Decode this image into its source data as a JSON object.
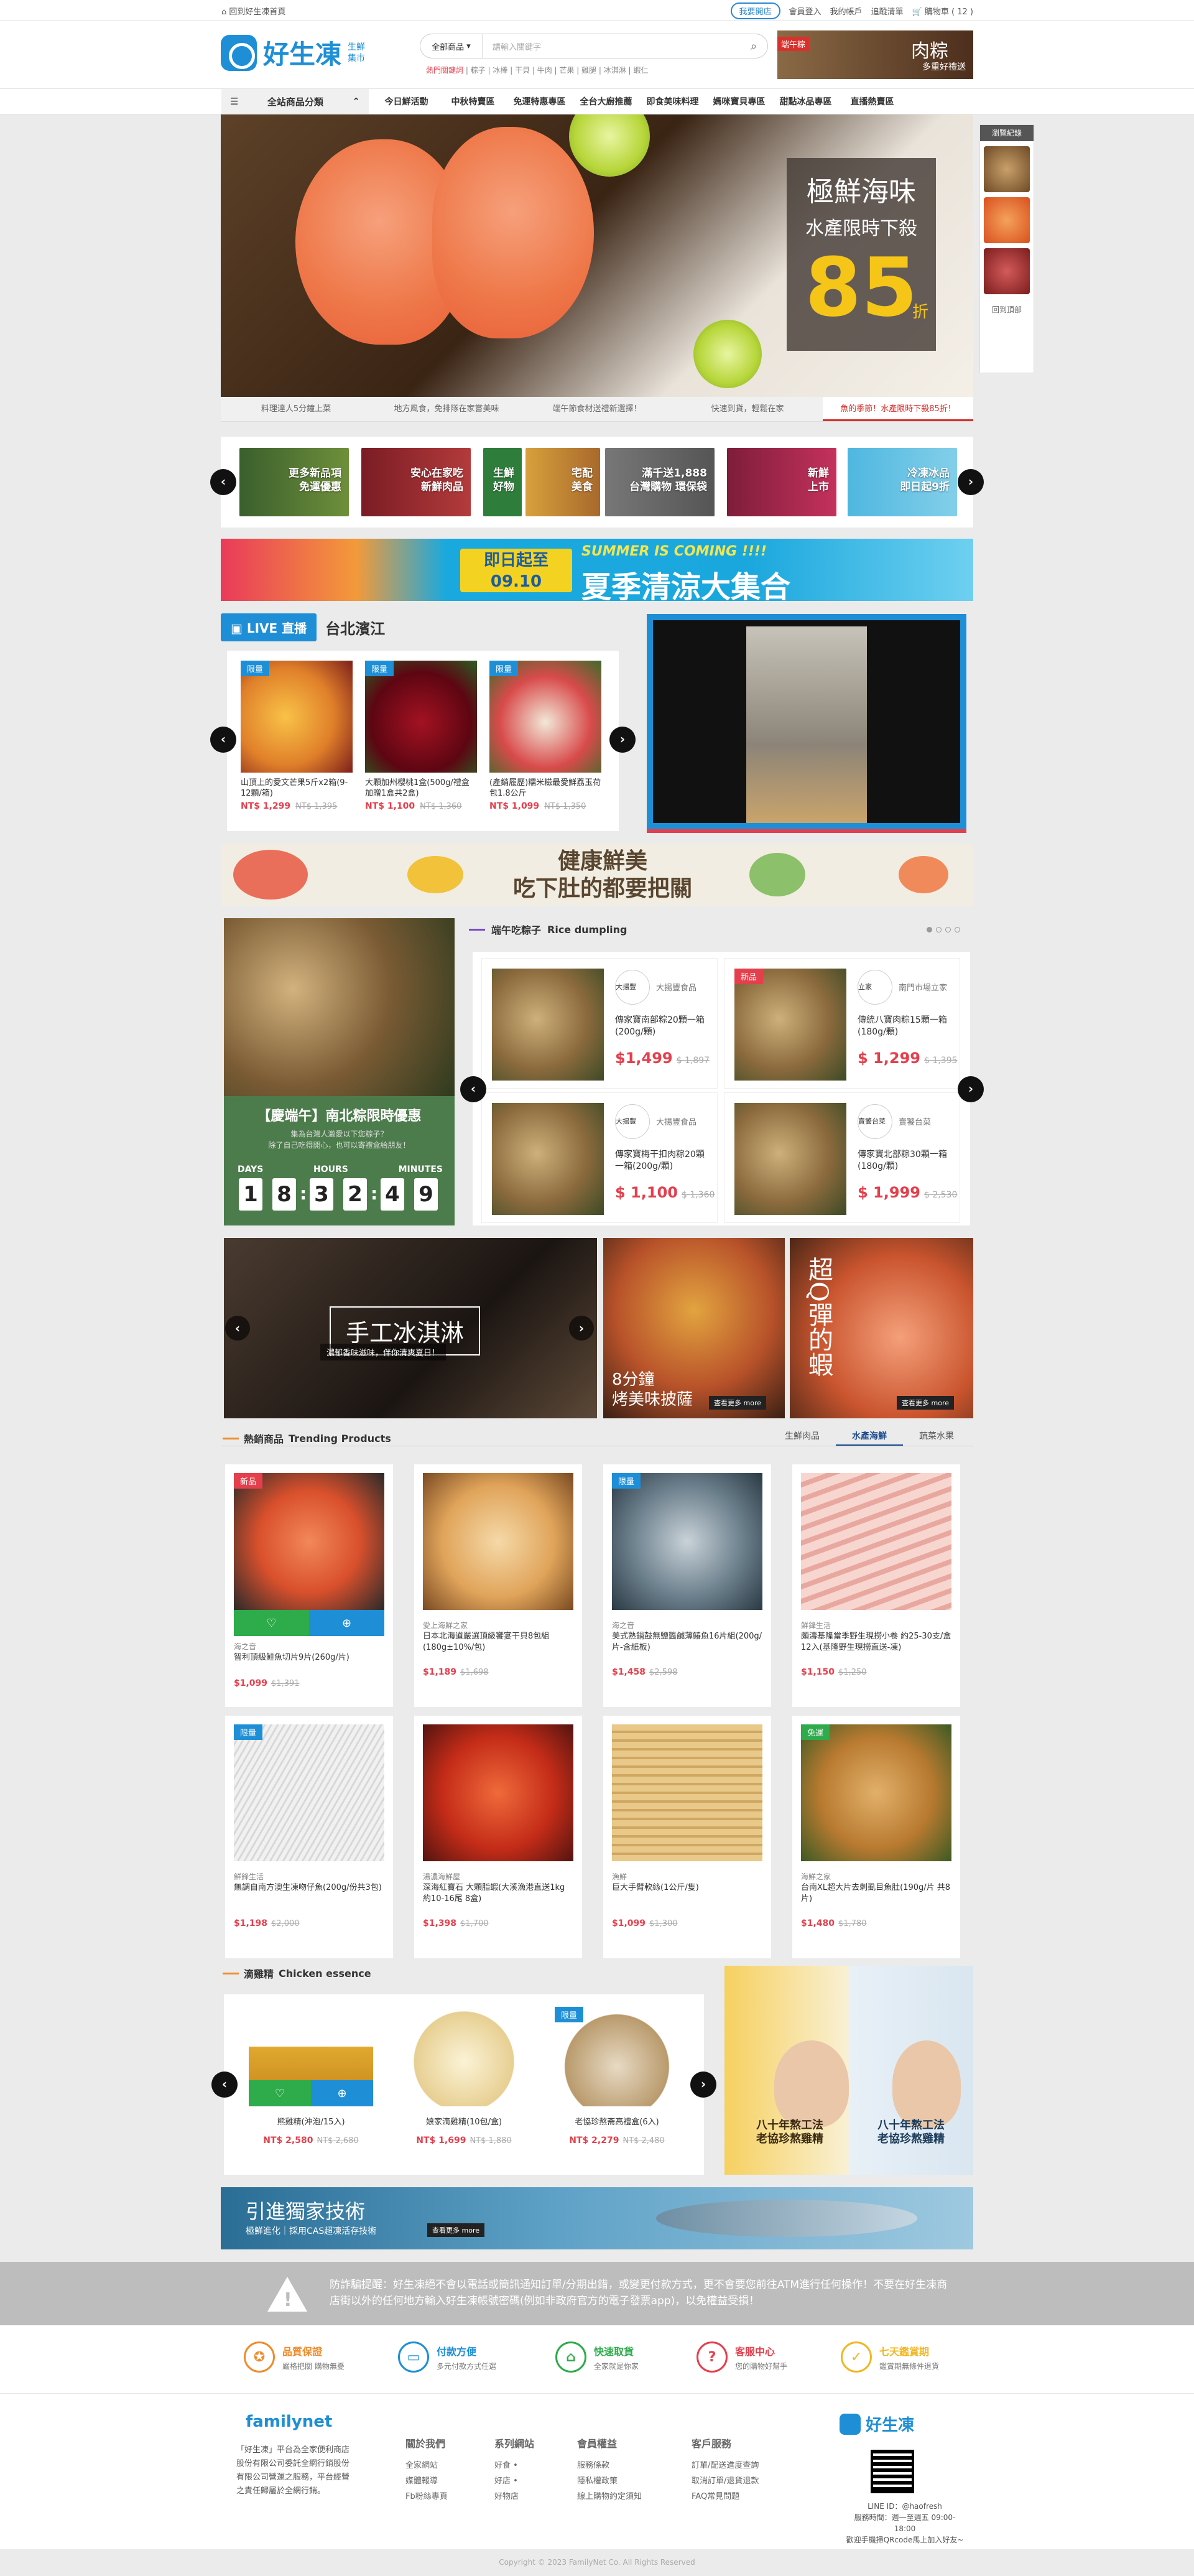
{
  "topbar": {
    "home": "回到好生凍首頁",
    "store_btn": "我要開店",
    "login": "會員登入",
    "account": "我的帳戶",
    "track": "追蹤清單",
    "cart": "購物車 ( 12 )"
  },
  "header": {
    "brand": "好生凍",
    "brand_sub1": "生鮮",
    "brand_sub2": "集市",
    "search_cat": "全部商品",
    "search_placeholder": "請輸入關鍵字",
    "hot_label": "熱門關鍵詞",
    "hot_keywords": "| 粽子 | 冰棒 | 干貝 | 牛肉 | 芒果 | 雞腿 | 冰淇淋 | 蝦仁",
    "ad_tag": "端午粽",
    "ad_title": "肉粽",
    "ad_sub": "多重好禮送"
  },
  "nav": {
    "all": "全站商品分類",
    "items": [
      "今日鮮活動",
      "中秋特賣區",
      "免運特惠專區",
      "全台大廚推薦",
      "即食美味料理",
      "媽咪寶貝專區",
      "甜點冰品專區",
      "直播熱賣區"
    ]
  },
  "banner": {
    "line1": "極鮮海味",
    "line2": "水產限時下殺",
    "number": "85",
    "unit": "折",
    "tabs": [
      "料理達人5分鐘上菜",
      "地方風食，免排隊在家嘗美味",
      "端午節食材送禮新選擇！",
      "快速到貨，輕鬆在家",
      "魚的季節！水產限時下殺85折！"
    ]
  },
  "history": {
    "title": "瀏覽紀錄",
    "footer": "回到頂部"
  },
  "catcar": {
    "tiles": [
      "更多新品項\n免運優惠",
      "安心在家吃\n新鮮肉品",
      "生鮮\n好物",
      "宅配\n美食",
      "滿千送1,888\n台灣購物 環保袋",
      "新鮮\n上市",
      "冷凍冰品\n即日起9折"
    ]
  },
  "summer": {
    "date_top": "即日起至",
    "date": "09.10",
    "tagline": "SUMMER IS COMING !!!!",
    "title": "夏季清涼大集合"
  },
  "live": {
    "badge": "LIVE 直播",
    "location": "台北濱江",
    "products": [
      {
        "badge": "限量",
        "name": "山頂上的愛文芒果5斤x2箱(9-12顆/箱)",
        "price": "NT$ 1,299",
        "old": "NT$ 1,395"
      },
      {
        "badge": "限量",
        "name": "大顆加州櫻桃1盒(500g/禮盒 加贈1盒共2盒)",
        "price": "NT$ 1,100",
        "old": "NT$ 1,360"
      },
      {
        "badge": "限量",
        "name": "(產銷履歷)糯米糍最愛鮮荔玉荷包1.8公斤",
        "price": "NT$ 1,099",
        "old": "NT$ 1,350"
      }
    ]
  },
  "healthy": {
    "line1": "健康鮮美",
    "line2": "吃下肚的都要把關"
  },
  "dumpling": {
    "title": "端午吃粽子",
    "title_en": "Rice dumpling",
    "promo_title": "【慶端午】南北粽限時優惠",
    "promo_sub": "集為台灣人激愛以下您粽子？\n除了自己吃得開心，也可以寄禮盒給朋友！",
    "cd_labels": [
      "DAYS",
      "HOURS",
      "MINUTES"
    ],
    "cd": [
      "1",
      "8",
      "3",
      "2",
      "4",
      "9"
    ],
    "products": [
      {
        "shop": "大揚豐食品",
        "logo": "大揚豐",
        "name": "傳家寶南部粽20顆一箱(200g/顆)",
        "price": "$1,499",
        "old": "$ 1,897",
        "badge": ""
      },
      {
        "shop": "南門市場立家",
        "logo": "立家",
        "name": "傳統八寶肉粽15顆一箱(180g/顆)",
        "price": "$ 1,299",
        "old": "$ 1,395",
        "badge": "新品"
      },
      {
        "shop": "大揚豐食品",
        "logo": "大揚豐",
        "name": "傳家寶梅干扣肉粽20顆一箱(200g/顆)",
        "price": "$ 1,100",
        "old": "$ 1,360",
        "badge": ""
      },
      {
        "shop": "賣饕台菜",
        "logo": "賣饕台菜",
        "name": "傳家寶北部粽30顆一箱(180g/顆)",
        "price": "$ 1,999",
        "old": "$ 2,530",
        "badge": ""
      }
    ]
  },
  "promos": {
    "icecream": "手工冰淇淋",
    "icecream_sub": "濃郁香味滋味，伴你清爽夏日！",
    "pizza_line1": "8分鐘",
    "pizza_line2": "烤美味披薩",
    "more": "查看更多 more",
    "shrimp": "超Q彈的蝦"
  },
  "trending": {
    "title": "熱銷商品",
    "title_en": "Trending Products",
    "tabs": [
      "生鮮肉品",
      "水產海鮮",
      "蔬菜水果"
    ],
    "active_tab": 1,
    "products": [
      {
        "badge": "新品",
        "shop": "海之音",
        "name": "智利頂級鮭魚切片9片(260g/片)",
        "price": "$1,099",
        "old": "$1,391"
      },
      {
        "badge": "",
        "shop": "愛上海鮮之家",
        "name": "日本北海道嚴選頂級饗宴干貝8包組(180g±10%/包)",
        "price": "$1,189",
        "old": "$1,698"
      },
      {
        "badge": "限量",
        "shop": "海之音",
        "name": "美式熟鍋鼓無鹽醬鹹薄鰆魚16片組(200g/片-含紙板)",
        "price": "$1,458",
        "old": "$2,598"
      },
      {
        "badge": "",
        "shop": "鮮鋒生活",
        "name": "頗濤基隆當季野生現撈小卷 約25-30支/盒 12入(基隆野生現撈直送-凍)",
        "price": "$1,150",
        "old": "$1,250"
      },
      {
        "badge": "限量",
        "shop": "鮮鋒生活",
        "name": "無調自南方澳生凍吻仔魚(200g/份共3包)",
        "price": "$1,198",
        "old": "$2,000"
      },
      {
        "badge": "",
        "shop": "湯濃海鮮屋",
        "name": "深海紅寶石 大顆脂蝦(大溪漁港直送1kg 約10-16尾 8盒)",
        "price": "$1,398",
        "old": "$1,700"
      },
      {
        "badge": "",
        "shop": "漁鮮",
        "name": "巨大手臂軟絲(1公斤/隻)",
        "price": "$1,099",
        "old": "$1,300"
      },
      {
        "badge": "免運",
        "shop": "海鮮之家",
        "name": "台南XL超大片去刺虱目魚肚(190g/片 共8片)",
        "price": "$1,480",
        "old": "$1,780"
      }
    ]
  },
  "chicken": {
    "title": "滴雞精",
    "title_en": "Chicken essence",
    "products": [
      {
        "badge": "",
        "name": "熊雞精(沖泡/15入)",
        "price": "NT$ 2,580",
        "old": "NT$ 2,680"
      },
      {
        "badge": "",
        "name": "娘家滴雞精(10包/盒)",
        "price": "NT$ 1,699",
        "old": "NT$ 1,880"
      },
      {
        "badge": "限量",
        "name": "老協珍熬斋高禮盒(6入)",
        "price": "NT$ 2,279",
        "old": "NT$ 2,480"
      }
    ],
    "ad_left": "八十年熬工法\n老協珍熬雞精",
    "ad_right": "八十年熬工法\n老協珍熬雞精"
  },
  "tech": {
    "title": "引進獨家技術",
    "sub": "極鮮進化｜採用CAS超凍活存技術",
    "more": "查看更多 more"
  },
  "notice": {
    "text": "防詐騙提醒：好生凍絕不會以電話或簡訊通知訂單/分期出錯，或變更付款方式，更不會要您前往ATM進行任何操作！不要在好生凍商店街以外的任何地方輸入好生凍帳號密碼(例如非政府官方的電子發票app)，以免權益受損！"
  },
  "features": [
    {
      "t": "品質保證",
      "s": "嚴格把關 購物無憂",
      "c": "#f08b2a",
      "i": "✪"
    },
    {
      "t": "付款方便",
      "s": "多元付款方式任選",
      "c": "#1e8fd6",
      "i": "▭"
    },
    {
      "t": "快速取貨",
      "s": "全家就是你家",
      "c": "#2eab4a",
      "i": "⌂"
    },
    {
      "t": "客服中心",
      "s": "您的購物好幫手",
      "c": "#e43f4c",
      "i": "?"
    },
    {
      "t": "七天鑑賞期",
      "s": "鑑賞期無條件退貨",
      "c": "#f2b622",
      "i": "✓"
    }
  ],
  "footer": {
    "brand": "familynet",
    "desc": "「好生凍」平台為全家便利商店股份有限公司委託全網行銷股份有限公司營運之服務，平台經營之責任歸屬於全網行銷。",
    "cols": [
      {
        "h": "關於我們",
        "items": [
          "全家網站",
          "媒體報導",
          "Fb粉絲專頁"
        ]
      },
      {
        "h": "系列網站",
        "items": [
          "好食 •",
          "好店 •",
          "好物店"
        ]
      },
      {
        "h": "會員權益",
        "items": [
          "服務條款",
          "隱私權政策",
          "線上購物約定須知"
        ]
      },
      {
        "h": "客戶服務",
        "items": [
          "訂單/配送進度查詢",
          "取消訂單/退貨退款",
          "FAQ常見問題"
        ]
      }
    ],
    "brand2": "好生凍",
    "line": "LINE ID：@haofresh",
    "hours": "服務時間：週一至週五 09:00-18:00",
    "qr_note": "歡迎手機掃QRcode馬上加入好友~"
  },
  "copyright": "Copyright © 2023 FamilyNet Co. All Rights Reserved"
}
